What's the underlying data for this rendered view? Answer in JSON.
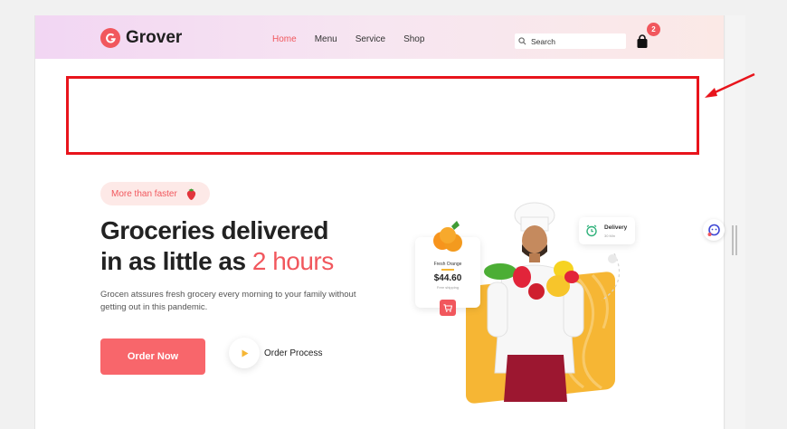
{
  "header": {
    "logo_text": "Grover",
    "nav": [
      {
        "label": "Home",
        "active": true
      },
      {
        "label": "Menu",
        "active": false
      },
      {
        "label": "Service",
        "active": false
      },
      {
        "label": "Shop",
        "active": false
      }
    ],
    "search_placeholder": "Search",
    "cart_count": "2"
  },
  "hero": {
    "tag_text": "More than faster",
    "headline_line1": "Groceries delivered",
    "headline_line2_prefix": "in as little as ",
    "headline_highlight": "2 hours",
    "description": "Grocen atssures fresh grocery every morning to your family without getting out in this pandemic.",
    "order_button": "Order Now",
    "process_label": "Order Process"
  },
  "product_card": {
    "title": "Fresh Orange",
    "price": "$44.60",
    "subtitle": "Free shipping"
  },
  "delivery_card": {
    "title": "Delivery",
    "subtitle": "30 Min"
  },
  "colors": {
    "accent": "#f1575d",
    "button": "#f8666b",
    "annotation": "#e8141c",
    "yellow": "#f6b634"
  }
}
